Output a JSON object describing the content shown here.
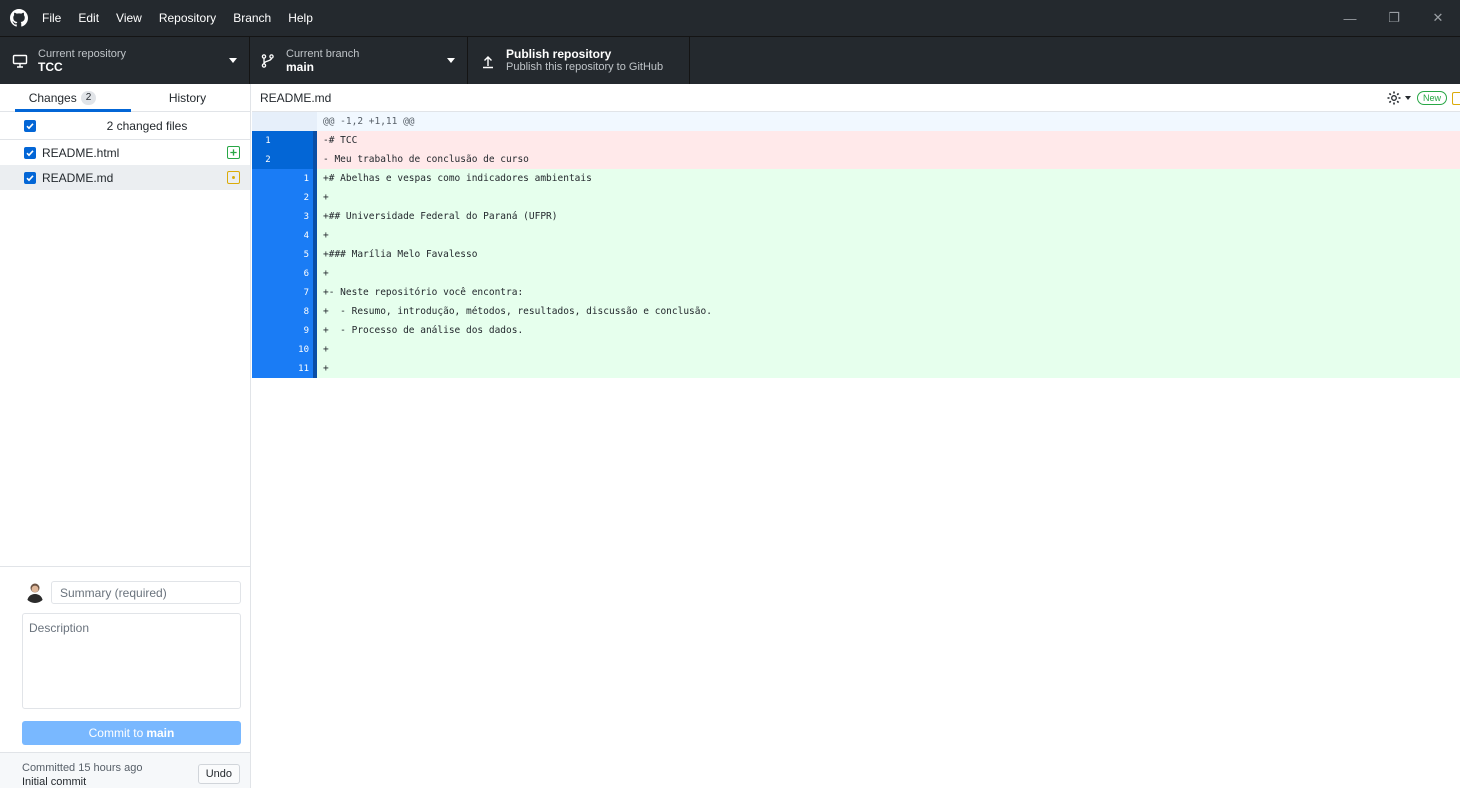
{
  "menu": [
    "File",
    "Edit",
    "View",
    "Repository",
    "Branch",
    "Help"
  ],
  "window_controls": {
    "minimize": "—",
    "restore": "❐",
    "close": "✕"
  },
  "toolbar": {
    "repo_label": "Current repository",
    "repo_value": "TCC",
    "branch_label": "Current branch",
    "branch_value": "main",
    "publish_title": "Publish repository",
    "publish_subtitle": "Publish this repository to GitHub"
  },
  "sidebar": {
    "tab_changes": "Changes",
    "changes_count": "2",
    "tab_history": "History",
    "files_header": "2 changed files",
    "files": [
      {
        "name": "README.html",
        "status": "added",
        "status_color": "#28a745"
      },
      {
        "name": "README.md",
        "status": "modified",
        "status_color": "#dbab09"
      }
    ]
  },
  "commit": {
    "summary_placeholder": "Summary (required)",
    "description_placeholder": "Description",
    "button_prefix": "Commit to",
    "button_branch": "main",
    "last_commit_time": "Committed 15 hours ago",
    "last_commit_message": "Initial commit",
    "undo_label": "Undo"
  },
  "diff": {
    "filename": "README.md",
    "new_badge": "New",
    "hunk_header": "@@ -1,2 +1,11 @@",
    "lines": [
      {
        "type": "del",
        "old": "1",
        "new": "",
        "text": "-# TCC",
        "heading": true
      },
      {
        "type": "del",
        "old": "2",
        "new": "",
        "text": "- Meu trabalho de conclusão de curso",
        "heading": false
      },
      {
        "type": "add",
        "old": "",
        "new": "1",
        "text": "+# Abelhas e vespas como indicadores ambientais",
        "heading": true
      },
      {
        "type": "add",
        "old": "",
        "new": "2",
        "text": "+",
        "heading": false
      },
      {
        "type": "add",
        "old": "",
        "new": "3",
        "text": "+## Universidade Federal do Paraná (UFPR)",
        "heading": true
      },
      {
        "type": "add",
        "old": "",
        "new": "4",
        "text": "+",
        "heading": false
      },
      {
        "type": "add",
        "old": "",
        "new": "5",
        "text": "+### Marília Melo Favalesso",
        "heading": true
      },
      {
        "type": "add",
        "old": "",
        "new": "6",
        "text": "+",
        "heading": false
      },
      {
        "type": "add",
        "old": "",
        "new": "7",
        "text": "+- Neste repositório você encontra:",
        "heading": false
      },
      {
        "type": "add",
        "old": "",
        "new": "8",
        "text": "+  - Resumo, introdução, métodos, resultados, discussão e conclusão.",
        "heading": false
      },
      {
        "type": "add",
        "old": "",
        "new": "9",
        "text": "+  - Processo de análise dos dados.",
        "heading": false
      },
      {
        "type": "add",
        "old": "",
        "new": "10",
        "text": "+",
        "heading": false
      },
      {
        "type": "add",
        "old": "",
        "new": "11",
        "text": "+",
        "heading": false
      }
    ]
  },
  "colors": {
    "accent": "#0366d6",
    "toolbar_bg": "#24292e",
    "added": "#28a745",
    "modified": "#dbab09"
  }
}
